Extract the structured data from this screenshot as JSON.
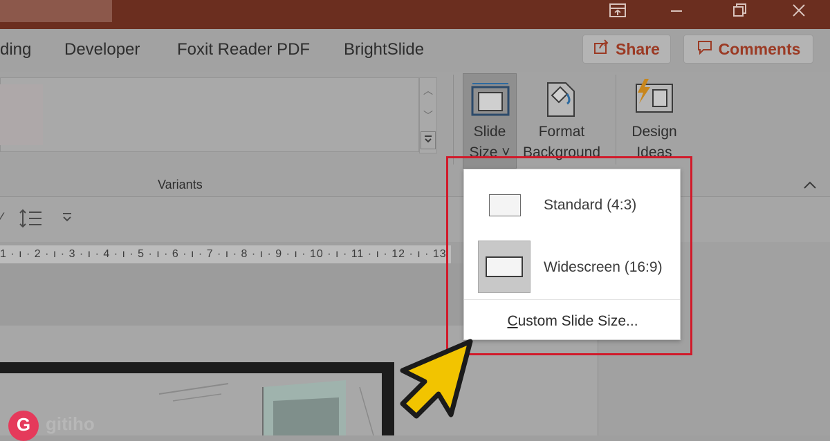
{
  "window": {
    "controls": [
      "ribbon-display-icon",
      "minimize-icon",
      "restore-icon",
      "close-icon"
    ]
  },
  "tabs": [
    "ding",
    "Developer",
    "Foxit Reader PDF",
    "BrightSlide"
  ],
  "header_actions": {
    "share_label": "Share",
    "comments_label": "Comments",
    "accent_color": "#9b3a24"
  },
  "ribbon": {
    "variants_label": "Variants",
    "slide_size": {
      "line1": "Slide",
      "line2": "Size ˅"
    },
    "format_background": {
      "line1": "Format",
      "line2": "Background"
    },
    "design_ideas": {
      "line1": "Design",
      "line2": "Ideas"
    }
  },
  "ruler": {
    "text": "1 · ı · 2 · ı · 3 · ı · 4 · ı · 5 · ı · 6 · ı · 7 · ı · 8 · ı · 9 · ı · 10 · ı · 11 · ı · 12 · ı · 13"
  },
  "slide_size_menu": {
    "items": [
      {
        "label": "Standard (4:3)",
        "icon": "standard-slide-icon",
        "selected": false
      },
      {
        "label": "Widescreen (16:9)",
        "icon": "widescreen-slide-icon",
        "selected": true
      }
    ],
    "custom_label_prefix": "C",
    "custom_label_rest": "ustom Slide Size...",
    "highlight_color": "#d11a2a"
  },
  "watermark": {
    "text": "gitiho",
    "logo_letter": "G"
  }
}
